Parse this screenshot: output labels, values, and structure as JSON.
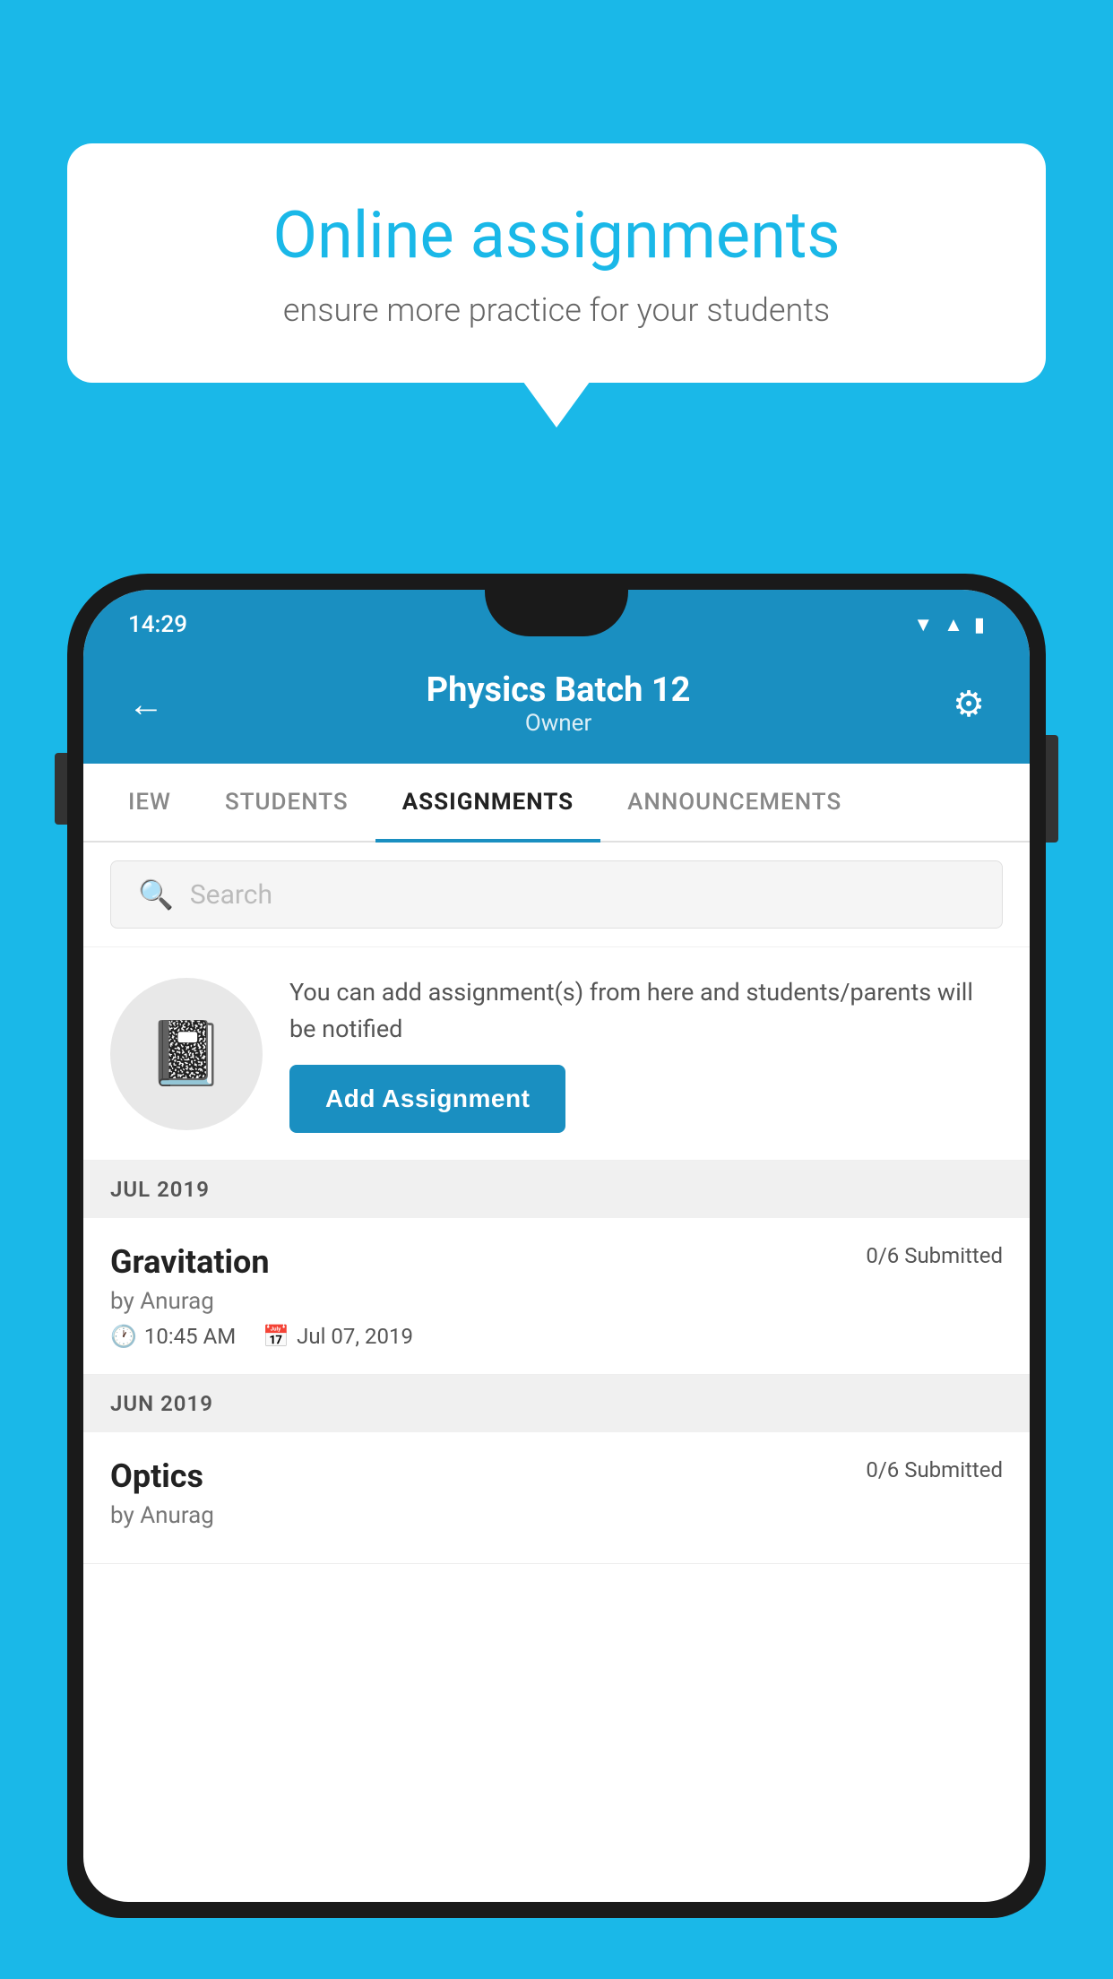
{
  "background_color": "#1ab8e8",
  "speech_bubble": {
    "title": "Online assignments",
    "subtitle": "ensure more practice for your students"
  },
  "phone": {
    "status_bar": {
      "time": "14:29",
      "icons": [
        "wifi",
        "signal",
        "battery"
      ]
    },
    "header": {
      "title": "Physics Batch 12",
      "subtitle": "Owner",
      "back_label": "←",
      "gear_label": "⚙"
    },
    "tabs": [
      {
        "label": "IEW",
        "active": false
      },
      {
        "label": "STUDENTS",
        "active": false
      },
      {
        "label": "ASSIGNMENTS",
        "active": true
      },
      {
        "label": "ANNOUNCEMENTS",
        "active": false
      }
    ],
    "search": {
      "placeholder": "Search"
    },
    "info_card": {
      "description": "You can add assignment(s) from here and students/parents will be notified",
      "button_label": "Add Assignment"
    },
    "sections": [
      {
        "month_label": "JUL 2019",
        "assignments": [
          {
            "title": "Gravitation",
            "submitted": "0/6 Submitted",
            "by": "by Anurag",
            "time": "10:45 AM",
            "date": "Jul 07, 2019"
          }
        ]
      },
      {
        "month_label": "JUN 2019",
        "assignments": [
          {
            "title": "Optics",
            "submitted": "0/6 Submitted",
            "by": "by Anurag",
            "time": "",
            "date": ""
          }
        ]
      }
    ]
  }
}
